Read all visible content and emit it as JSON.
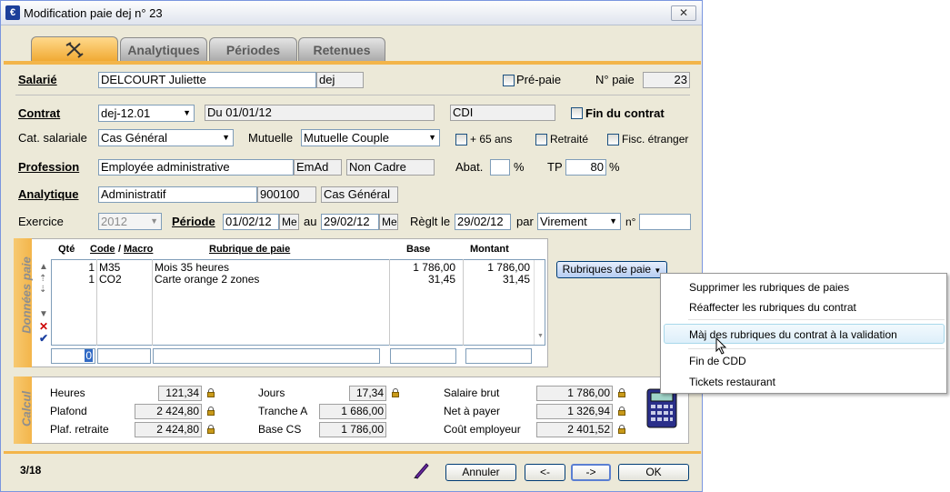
{
  "window": {
    "title": "Modification paie dej n° 23",
    "close": "✕"
  },
  "tabs": [
    {
      "label": ""
    },
    {
      "label": "Analytiques"
    },
    {
      "label": "Périodes"
    },
    {
      "label": "Retenues"
    }
  ],
  "salarie": {
    "label": "Salarié",
    "name": "DELCOURT Juliette",
    "code": "dej",
    "prepaie_label": "Pré-paie",
    "npaie_label": "N° paie",
    "npaie": "23"
  },
  "contrat": {
    "label": "Contrat",
    "value": "dej-12.01",
    "du": "Du 01/01/12",
    "type": "CDI",
    "fin_label": "Fin du contrat"
  },
  "cat": {
    "label": "Cat. salariale",
    "value": "Cas Général",
    "mutuelle_label": "Mutuelle",
    "mutuelle": "Mutuelle Couple",
    "plus65": "+ 65 ans",
    "retraite": "Retraité",
    "fisc": "Fisc. étranger"
  },
  "profession": {
    "label": "Profession",
    "value": "Employée administrative",
    "code": "EmAd",
    "statut": "Non Cadre",
    "abat_label": "Abat.",
    "abat": "",
    "pct": "%",
    "tp_label": "TP",
    "tp": "80",
    "pct2": "%"
  },
  "analytique": {
    "label": "Analytique",
    "value": "Administratif",
    "code": "900100",
    "cat": "Cas Général"
  },
  "periode": {
    "exercice_label": "Exercice",
    "exercice": "2012",
    "label": "Période",
    "from": "01/02/12",
    "from_suffix": "Me",
    "au": "au",
    "to": "29/02/12",
    "to_suffix": "Me",
    "reglt_label": "Règlt le",
    "reglt": "29/02/12",
    "par": "par",
    "mode": "Virement",
    "n_label": "n°",
    "n": ""
  },
  "donnees": {
    "title": "Données paie",
    "headers": {
      "qte": "Qté",
      "code": "Code",
      "slash": "/",
      "macro": "Macro",
      "rubrique": "Rubrique de paie",
      "base": "Base",
      "montant": "Montant"
    },
    "rows": [
      {
        "qte": "1",
        "code": "M35",
        "rubrique": "Mois 35 heures",
        "base": "1 786,00",
        "montant": "1 786,00"
      },
      {
        "qte": "1",
        "code": "CO2",
        "rubrique": "Carte orange 2 zones",
        "base": "31,45",
        "montant": "31,45"
      }
    ],
    "input_qte": "0",
    "rubriques_button": "Rubriques de paie"
  },
  "calcul": {
    "title": "Calcul",
    "heures_label": "Heures",
    "heures": "121,34",
    "plafond_label": "Plafond",
    "plafond": "2 424,80",
    "plafret_label": "Plaf. retraite",
    "plafret": "2 424,80",
    "jours_label": "Jours",
    "jours": "17,34",
    "trancheA_label": "Tranche A",
    "trancheA": "1 686,00",
    "basecs_label": "Base CS",
    "basecs": "1 786,00",
    "brut_label": "Salaire brut",
    "brut": "1 786,00",
    "net_label": "Net à payer",
    "net": "1 326,94",
    "cout_label": "Coût employeur",
    "cout": "2 401,52"
  },
  "footer": {
    "counter": "3/18",
    "annuler": "Annuler",
    "prev": "<-",
    "next": "->",
    "ok": "OK"
  },
  "menu": {
    "items": [
      "Supprimer les rubriques de paies",
      "Réaffecter les rubriques du contrat",
      "Màj des rubriques du contrat à la validation",
      "Fin de CDD",
      "Tickets restaurant"
    ]
  },
  "colors": {
    "accent": "#f3b54a",
    "tab_active": "#f0a830"
  }
}
